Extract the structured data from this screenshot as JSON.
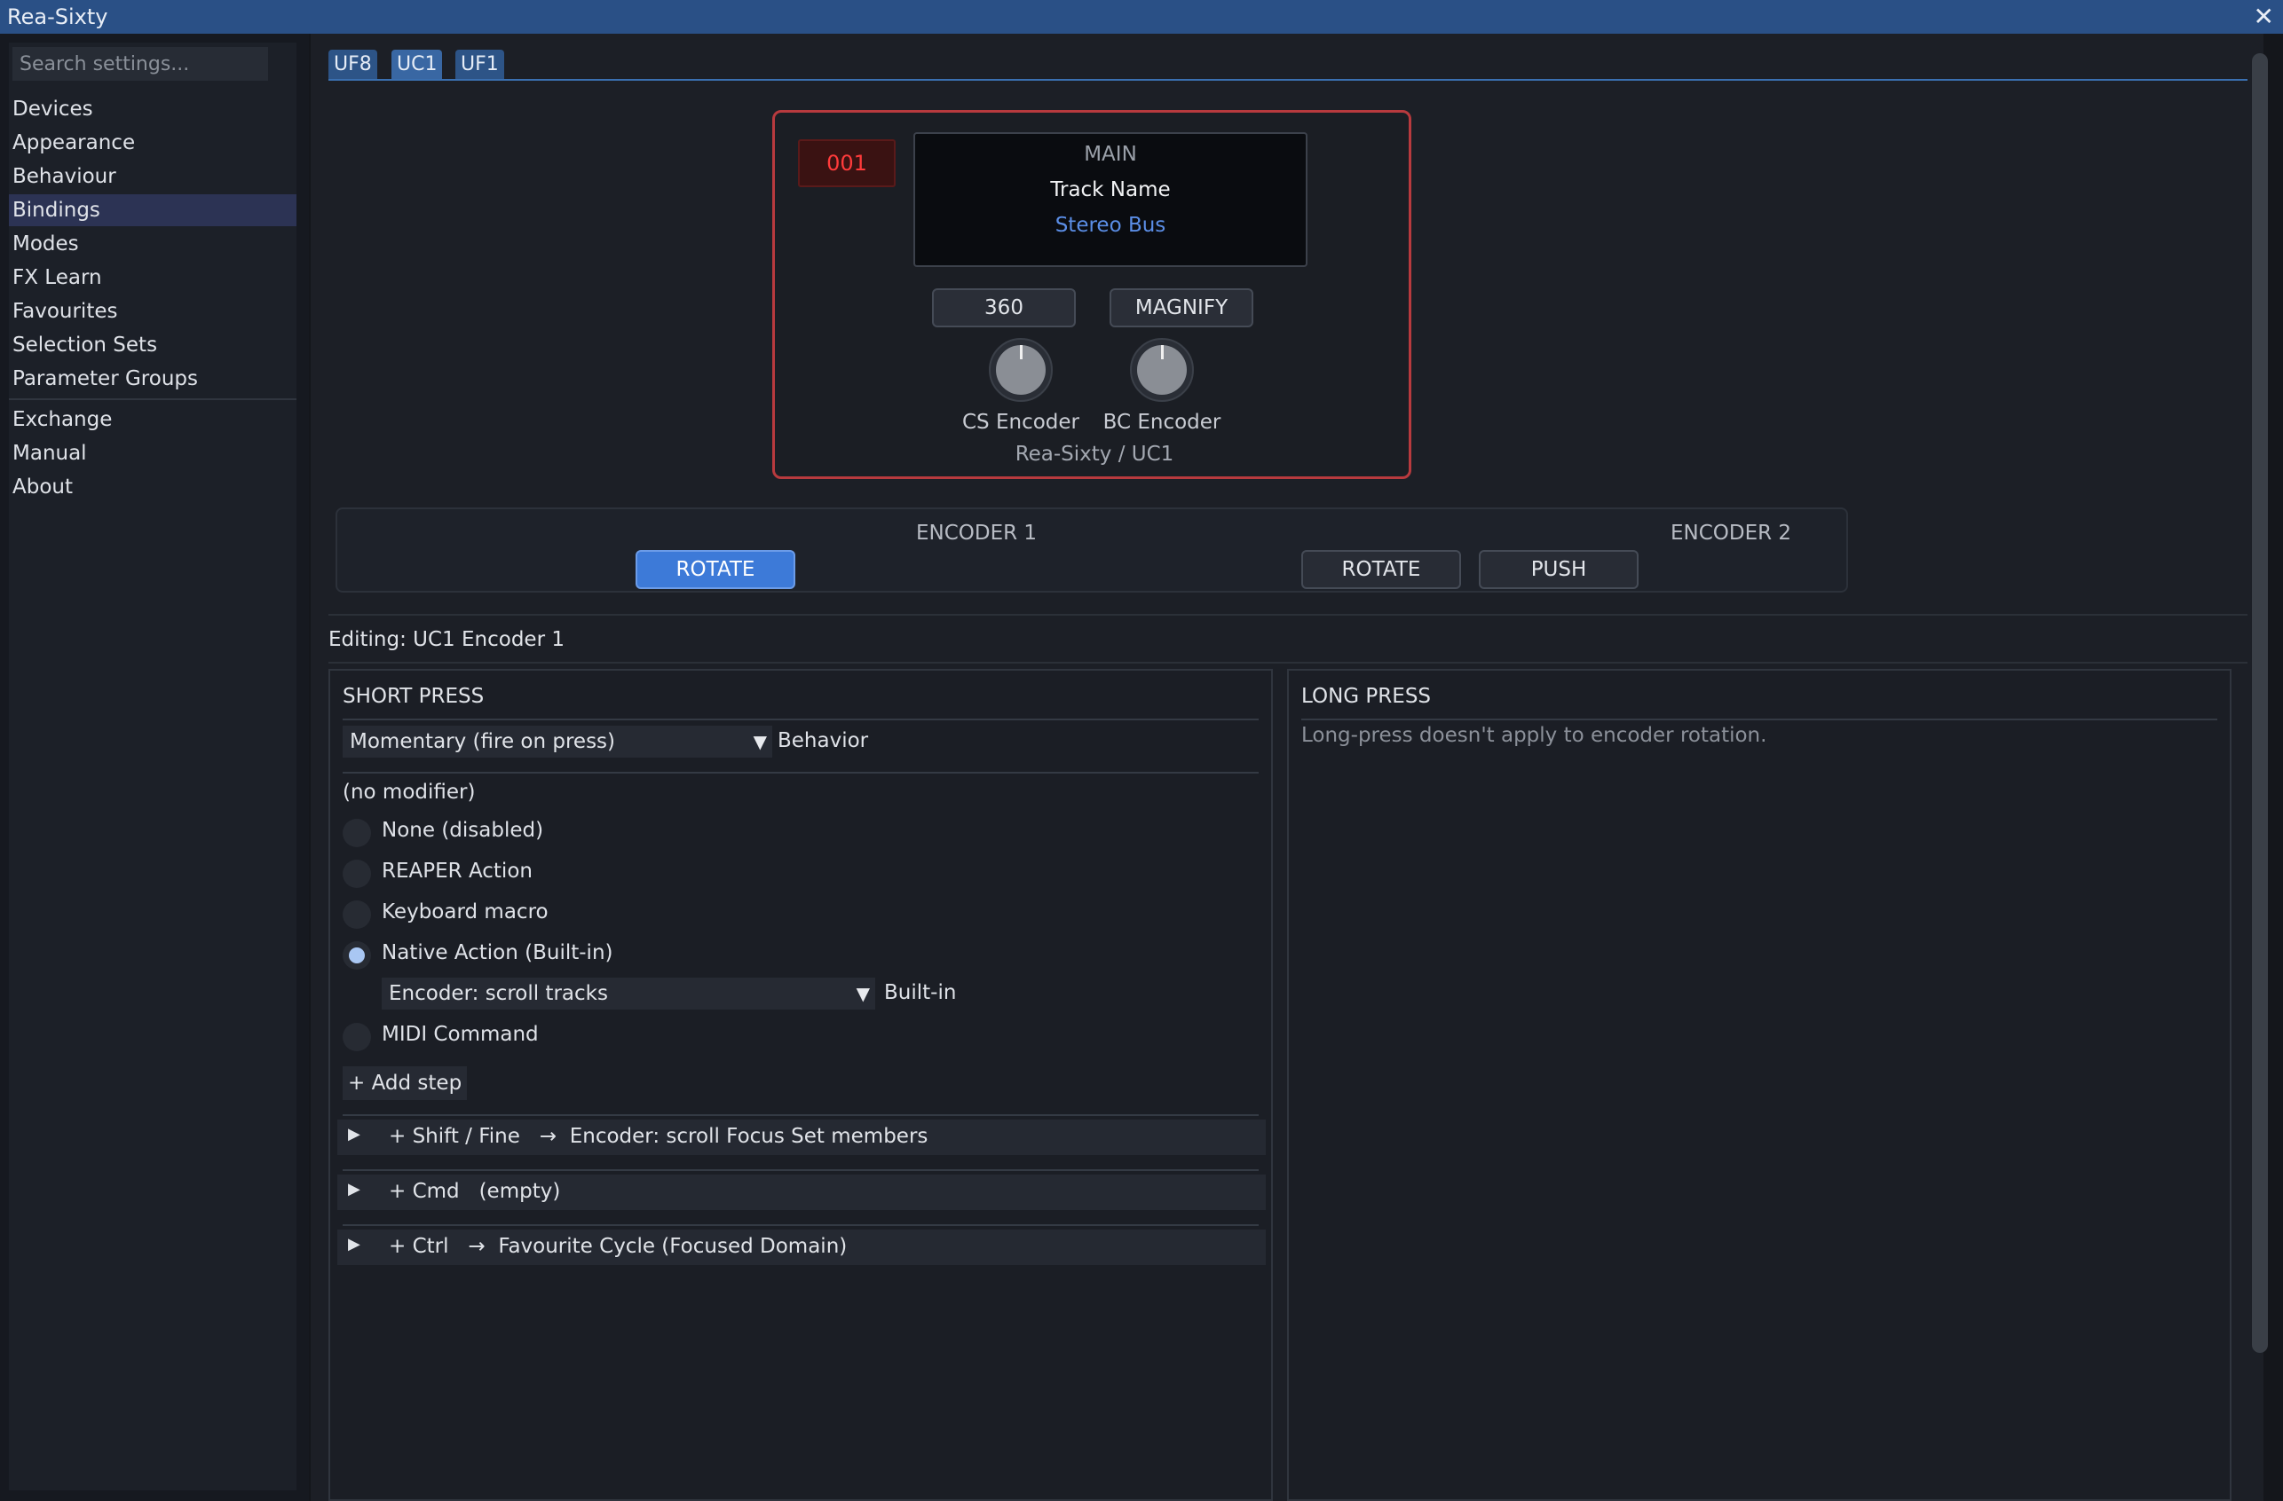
{
  "window": {
    "title": "Rea-Sixty",
    "close_glyph": "✕"
  },
  "sidebar": {
    "search_placeholder": "Search settings...",
    "items": [
      {
        "label": "Devices"
      },
      {
        "label": "Appearance"
      },
      {
        "label": "Behaviour"
      },
      {
        "label": "Bindings",
        "active": true
      },
      {
        "label": "Modes"
      },
      {
        "label": "FX Learn"
      },
      {
        "label": "Favourites"
      },
      {
        "label": "Selection Sets"
      },
      {
        "label": "Parameter Groups"
      }
    ],
    "items_secondary": [
      {
        "label": "Exchange"
      },
      {
        "label": "Manual"
      },
      {
        "label": "About"
      }
    ]
  },
  "tabs": [
    {
      "label": "UF8"
    },
    {
      "label": "UC1",
      "active": true
    },
    {
      "label": "UF1"
    }
  ],
  "device": {
    "channel_number": "001",
    "screen": {
      "mode": "MAIN",
      "track_label": "Track Name",
      "track_value": "Stereo Bus"
    },
    "buttons": {
      "left": "360",
      "right": "MAGNIFY"
    },
    "encoders": {
      "left": "CS Encoder",
      "right": "BC Encoder"
    },
    "caption": "Rea-Sixty / UC1",
    "accent_color": "#b83a3e"
  },
  "encoder_bar": {
    "encoder1": {
      "title": "ENCODER 1",
      "buttons": [
        "ROTATE"
      ]
    },
    "encoder2": {
      "title": "ENCODER 2",
      "buttons": [
        "ROTATE",
        "PUSH"
      ]
    }
  },
  "editing_label": "Editing: UC1 Encoder 1",
  "short_press": {
    "title": "SHORT PRESS",
    "behavior_value": "Momentary (fire on press)",
    "behavior_label": "Behavior",
    "modifier_label": "(no modifier)",
    "options": [
      {
        "label": "None (disabled)",
        "checked": false
      },
      {
        "label": "REAPER Action",
        "checked": false
      },
      {
        "label": "Keyboard macro",
        "checked": false
      },
      {
        "label": "Native Action (Built-in)",
        "checked": true
      },
      {
        "label": "MIDI Command",
        "checked": false
      }
    ],
    "native_action_value": "Encoder: scroll tracks",
    "native_action_label": "Built-in",
    "add_step": "+ Add step",
    "modifiers": [
      {
        "text": "+ Shift / Fine   →  Encoder: scroll Focus Set members"
      },
      {
        "text": "+ Cmd   (empty)"
      },
      {
        "text": "+ Ctrl   →  Favourite Cycle (Focused Domain)"
      }
    ]
  },
  "long_press": {
    "title": "LONG PRESS",
    "note": "Long-press doesn't apply to encoder rotation."
  },
  "colors": {
    "titlebar": "#2a5086",
    "tab_active": "#3967a3",
    "accent_blue": "#3d7ad8",
    "stereo_bus_text": "#5b8ee6",
    "display_red": "#ff3b3b"
  }
}
